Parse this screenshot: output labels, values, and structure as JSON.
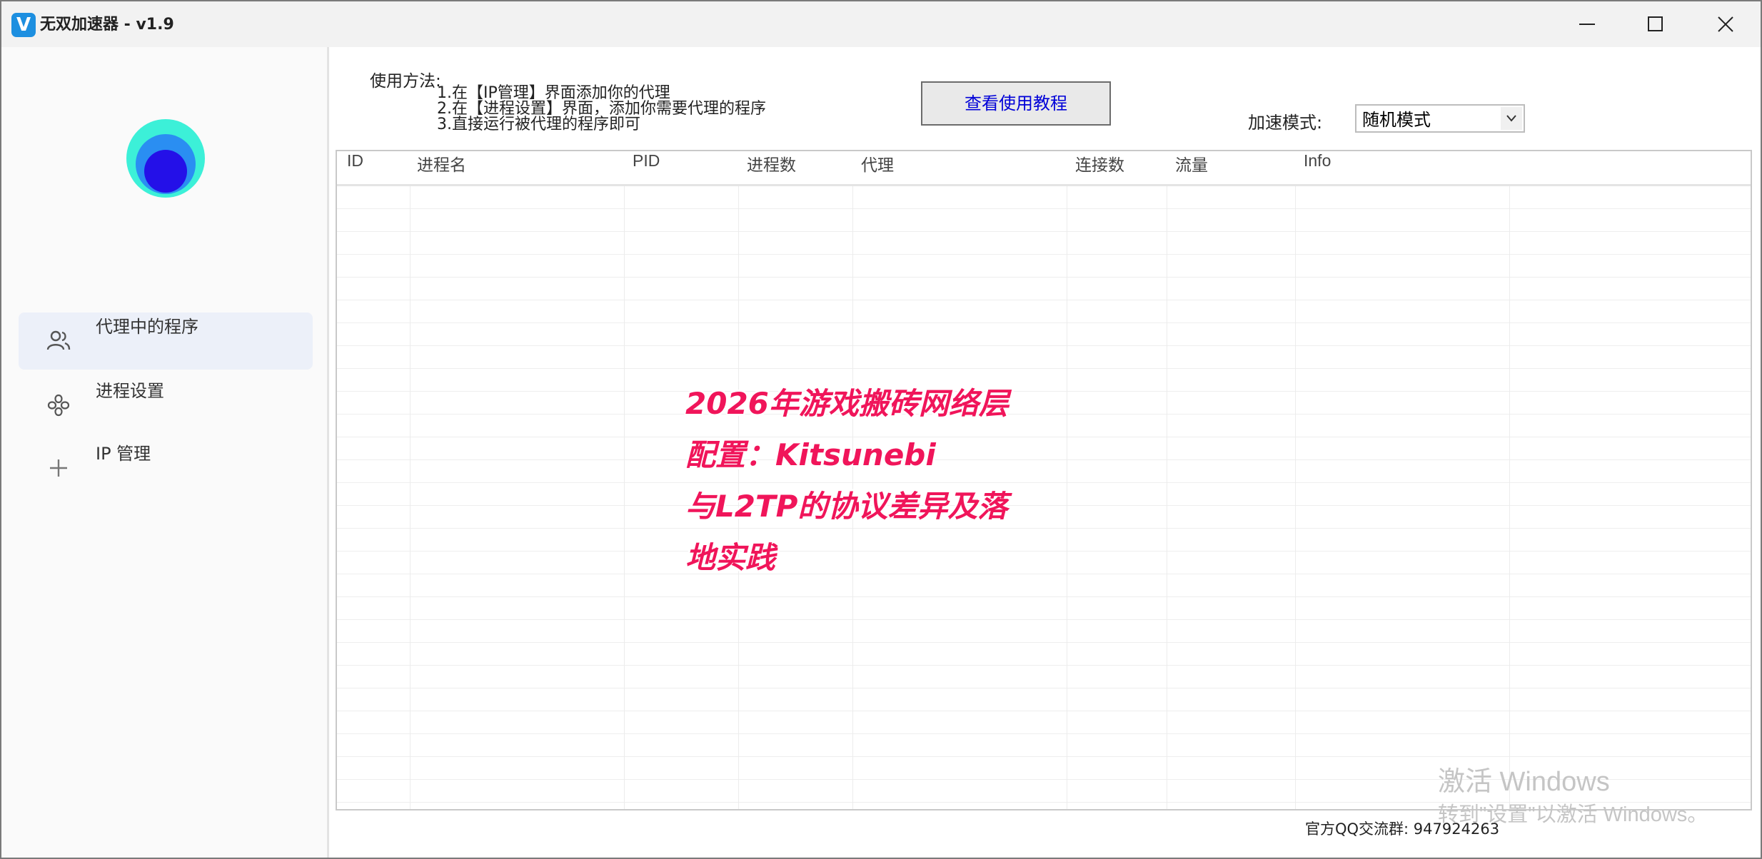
{
  "window": {
    "title": "无双加速器 - v1.9",
    "app_icon_letter": "V",
    "accent_color": "#1d8fe0"
  },
  "sidebar": {
    "items": [
      {
        "label": "代理中的程序",
        "icon": "users-icon",
        "active": true
      },
      {
        "label": "进程设置",
        "icon": "process-settings-icon",
        "active": false
      },
      {
        "label": "IP 管理",
        "icon": "plus-icon",
        "active": false
      }
    ]
  },
  "usage": {
    "title": "使用方法:",
    "steps": [
      "1.在【IP管理】界面添加你的代理",
      "2.在【进程设置】界面，添加你需要代理的程序",
      "3.直接运行被代理的程序即可"
    ]
  },
  "tutorial_button": "查看使用教程",
  "mode": {
    "label": "加速模式:",
    "selected": "随机模式"
  },
  "table": {
    "columns": [
      "ID",
      "进程名",
      "PID",
      "进程数",
      "代理",
      "连接数",
      "流量",
      "Info"
    ],
    "rows": []
  },
  "overlay": {
    "lines": [
      "2026年游戏搬砖网络层",
      "配置：Kitsunebi",
      "与L2TP的协议差异及落",
      "地实践"
    ],
    "color": "#f0155a"
  },
  "activation": {
    "title": "激活 Windows",
    "subtitle": "转到\"设置\"以激活 Windows。"
  },
  "footer": {
    "qq_group": "官方QQ交流群: 947924263"
  }
}
